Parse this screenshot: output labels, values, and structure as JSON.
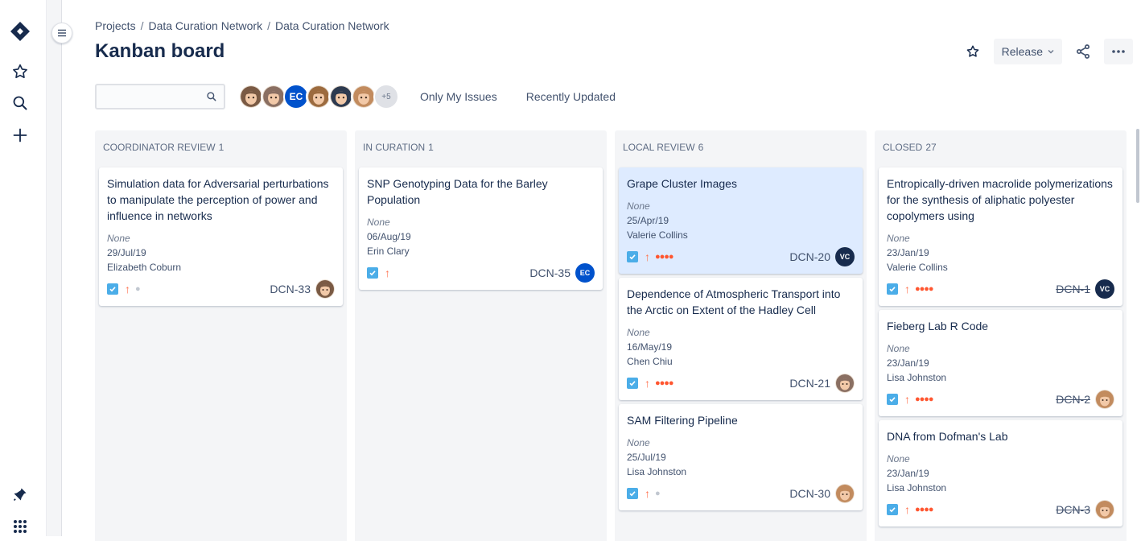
{
  "colors": {
    "accent": "#0052cc",
    "priority": "#ff7452",
    "estimate": "#ff5630",
    "selected_card": "#deebff"
  },
  "rail": {
    "icons": [
      "jira-logo-icon",
      "star-icon",
      "search-icon",
      "plus-icon",
      "notification-icon",
      "app-switcher-icon"
    ]
  },
  "breadcrumbs": [
    "Projects",
    "Data Curation Network",
    "Data Curation Network"
  ],
  "title": "Kanban board",
  "header_actions": {
    "release_label": "Release",
    "icons": [
      "star-icon",
      "share-icon",
      "more-icon"
    ]
  },
  "toolbar": {
    "search_placeholder": "",
    "avatars": [
      {
        "type": "photo",
        "color": "#7a5a44"
      },
      {
        "type": "photo",
        "color": "#8a6f62"
      },
      {
        "type": "initials",
        "initials": "EC"
      },
      {
        "type": "photo",
        "color": "#9c6b3f"
      },
      {
        "type": "photo",
        "color": "#2d3a4f"
      },
      {
        "type": "photo",
        "color": "#c28b5e"
      }
    ],
    "more_count": "+5",
    "filters": [
      "Only My Issues",
      "Recently Updated"
    ]
  },
  "columns": [
    {
      "title": "Coordinator Review",
      "count": "1",
      "cards": [
        {
          "title": "Simulation data for Adversarial perturbations to manipulate the perception of power and influence in networks",
          "status": "None",
          "date": "29/Jul/19",
          "assignee": "Elizabeth Coburn",
          "key": "DCN-33",
          "estimate": "low",
          "done": false,
          "selected": false,
          "avatar": {
            "type": "photo",
            "color": "#7a5a44"
          }
        }
      ]
    },
    {
      "title": "In Curation",
      "count": "1",
      "cards": [
        {
          "title": "SNP Genotyping Data for the Barley Population",
          "status": "None",
          "date": "06/Aug/19",
          "assignee": "Erin Clary",
          "key": "DCN-35",
          "estimate": "none",
          "done": false,
          "selected": false,
          "avatar": {
            "type": "initials",
            "initials": "EC",
            "color": "#0052cc"
          }
        }
      ]
    },
    {
      "title": "Local Review",
      "count": "6",
      "cards": [
        {
          "title": "Grape Cluster Images",
          "status": "None",
          "date": "25/Apr/19",
          "assignee": "Valerie Collins",
          "key": "DCN-20",
          "estimate": "high",
          "done": false,
          "selected": true,
          "avatar": {
            "type": "initials",
            "initials": "VC",
            "color": "#172b4d"
          }
        },
        {
          "title": "Dependence of Atmospheric Transport into the Arctic on Extent of the Hadley Cell",
          "status": "None",
          "date": "16/May/19",
          "assignee": "Chen Chiu",
          "key": "DCN-21",
          "estimate": "high",
          "done": false,
          "selected": false,
          "avatar": {
            "type": "photo",
            "color": "#8a6f62"
          }
        },
        {
          "title": "SAM Filtering Pipeline",
          "status": "None",
          "date": "25/Jul/19",
          "assignee": "Lisa Johnston",
          "key": "DCN-30",
          "estimate": "low",
          "done": false,
          "selected": false,
          "avatar": {
            "type": "photo",
            "color": "#c28b5e"
          }
        }
      ]
    },
    {
      "title": "Closed",
      "count": "27",
      "cards": [
        {
          "title": "Entropically-driven macrolide polymerizations for the synthesis of aliphatic polyester copolymers using",
          "status": "None",
          "date": "23/Jan/19",
          "assignee": "Valerie Collins",
          "key": "DCN-1",
          "estimate": "high",
          "done": true,
          "selected": false,
          "avatar": {
            "type": "initials",
            "initials": "VC",
            "color": "#172b4d"
          }
        },
        {
          "title": "Fieberg Lab R Code",
          "status": "None",
          "date": "23/Jan/19",
          "assignee": "Lisa Johnston",
          "key": "DCN-2",
          "estimate": "high",
          "done": true,
          "selected": false,
          "avatar": {
            "type": "photo",
            "color": "#c28b5e"
          }
        },
        {
          "title": "DNA from Dofman's Lab",
          "status": "None",
          "date": "23/Jan/19",
          "assignee": "Lisa Johnston",
          "key": "DCN-3",
          "estimate": "high",
          "done": true,
          "selected": false,
          "avatar": {
            "type": "photo",
            "color": "#c28b5e"
          }
        }
      ]
    }
  ]
}
